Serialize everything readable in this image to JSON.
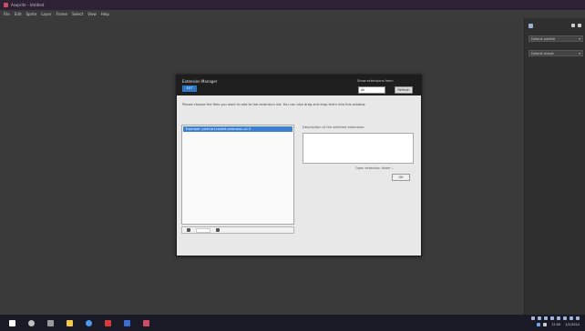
{
  "window": {
    "title": "Aseprite - Untitled",
    "accent": "#d04b64"
  },
  "menu": {
    "items": [
      "File",
      "Edit",
      "Sprite",
      "Layer",
      "Frame",
      "Select",
      "View",
      "Help"
    ]
  },
  "right_panel": {
    "dropdown1": "Default palette",
    "dropdown2": "Default tileset"
  },
  "dialog": {
    "title": "Extension Manager",
    "logo_text": "EXT",
    "top_right_label": "Show extensions from:",
    "select_value": "All",
    "top_button": "Refresh",
    "description": "Please choose the files you want to add to the extension list. You can also drag and drop them into this window.",
    "list_selected_item": "Example: pixel-art-toolkit-extension-v1.0",
    "right_label": "Description of the selected extension:",
    "link_label": "Open extension folder...",
    "small_button": "OK",
    "accent": "#3b7fd4"
  },
  "taskbar": {
    "time": "12:00",
    "date": "1/1/2024"
  }
}
